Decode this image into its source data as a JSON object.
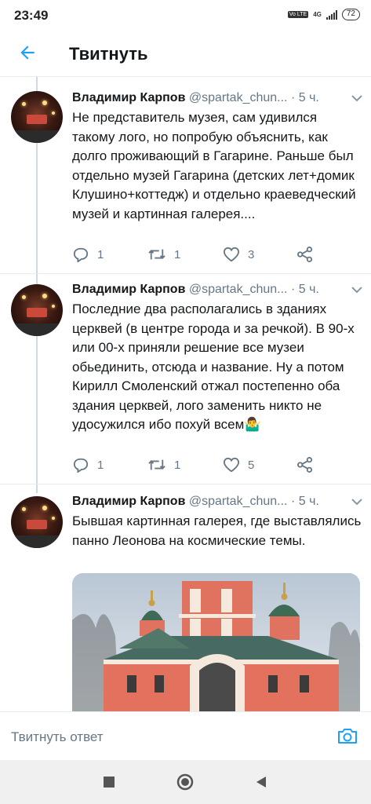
{
  "status_bar": {
    "time": "23:49",
    "network": "4G",
    "volte": "Vo LTE",
    "battery": "72"
  },
  "app_bar": {
    "back_icon": "arrow-left-icon",
    "title": "Твитнуть"
  },
  "tweets": [
    {
      "name": "Владимир Карпов",
      "handle": "@spartak_chun...",
      "dot": "·",
      "time": "5 ч.",
      "text": "Не представитель музея, сам удивился такому лого, но попробую объяснить, как долго проживающий в Гагарине. Раньше был отдельно музей Гагарина (детских лет+домик Клушино+коттедж) и отдельно краеведческий музей и картинная галерея....",
      "replies": "1",
      "retweets": "1",
      "likes": "3"
    },
    {
      "name": "Владимир Карпов",
      "handle": "@spartak_chun...",
      "dot": "·",
      "time": "5 ч.",
      "text": "Последние два располагались в зданиях церквей (в центре города и за речкой). В 90-х или 00-х приняли решение все музеи обьединить, отсюда и название. Ну а потом Кирилл Смоленский отжал постепенно оба здания церквей, лого заменить никто не удосужился ибо похуй всем🤷‍♂️",
      "replies": "1",
      "retweets": "1",
      "likes": "5"
    },
    {
      "name": "Владимир Карпов",
      "handle": "@spartak_chun...",
      "dot": "·",
      "time": "5 ч.",
      "text": "Бывшая картинная галерея, где выставлялись панно Леонова на космические темы."
    }
  ],
  "reply_bar": {
    "placeholder": "Твитнуть ответ",
    "camera_icon": "camera-icon"
  },
  "colors": {
    "accent": "#1da1f2",
    "text": "#14171a",
    "secondary": "#657786",
    "divider": "#e6ecf0"
  }
}
